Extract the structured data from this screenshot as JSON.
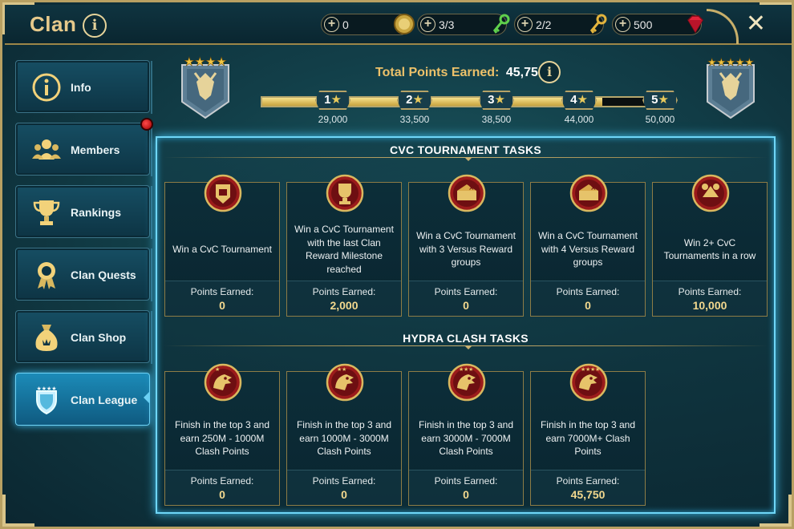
{
  "header": {
    "title": "Clan",
    "resources": [
      {
        "value": "0",
        "icon": "gold-coin-icon"
      },
      {
        "value": "3/3",
        "icon": "green-key-icon"
      },
      {
        "value": "2/2",
        "icon": "gold-key-icon"
      },
      {
        "value": "500",
        "icon": "ruby-gem-icon"
      }
    ]
  },
  "sidebar": {
    "items": [
      {
        "label": "Info",
        "icon": "info-icon"
      },
      {
        "label": "Members",
        "icon": "members-icon"
      },
      {
        "label": "Rankings",
        "icon": "trophy-icon"
      },
      {
        "label": "Clan Quests",
        "icon": "medal-icon"
      },
      {
        "label": "Clan Shop",
        "icon": "money-bag-icon"
      },
      {
        "label": "Clan League",
        "icon": "shield-icon"
      }
    ],
    "active": "Clan League"
  },
  "progress": {
    "total_label": "Total Points Earned:",
    "total_value": "45,750",
    "current_points": 45750,
    "milestones": [
      {
        "stars": "1",
        "points": "29,000",
        "value": 29000
      },
      {
        "stars": "2",
        "points": "33,500",
        "value": 33500
      },
      {
        "stars": "3",
        "points": "38,500",
        "value": 38500
      },
      {
        "stars": "4",
        "points": "44,000",
        "value": 44000
      },
      {
        "stars": "5",
        "points": "50,000",
        "value": 50000
      }
    ],
    "left_banner_stars": 4,
    "right_banner_stars": 5
  },
  "sections": {
    "cvc": {
      "title": "CVC TOURNAMENT TASKS",
      "tasks": [
        {
          "desc": "Win a CvC Tournament",
          "pts_label": "Points Earned:",
          "pts": "0",
          "icon": "cvc-helmet-badge-icon"
        },
        {
          "desc": "Win a CvC Tournament with the last Clan Reward Milestone reached",
          "pts_label": "Points Earned:",
          "pts": "2,000",
          "icon": "cvc-trophy-badge-icon"
        },
        {
          "desc": "Win a CvC Tournament with 3 Versus Reward groups",
          "pts_label": "Points Earned:",
          "pts": "0",
          "icon": "cvc-x3-badge-icon"
        },
        {
          "desc": "Win a CvC Tournament with 4 Versus Reward groups",
          "pts_label": "Points Earned:",
          "pts": "0",
          "icon": "cvc-x4-badge-icon"
        },
        {
          "desc": "Win 2+ CvC Tournaments in a row",
          "pts_label": "Points Earned:",
          "pts": "10,000",
          "icon": "cvc-streak-badge-icon"
        }
      ]
    },
    "hydra": {
      "title": "HYDRA CLASH TASKS",
      "tasks": [
        {
          "desc": "Finish in the top 3 and earn 250M - 1000M Clash Points",
          "pts_label": "Points Earned:",
          "pts": "0",
          "icon": "hydra-badge-icon"
        },
        {
          "desc": "Finish in the top 3 and earn 1000M - 3000M Clash Points",
          "pts_label": "Points Earned:",
          "pts": "0",
          "icon": "hydra-badge-icon"
        },
        {
          "desc": "Finish in the top 3 and earn 3000M - 7000M Clash Points",
          "pts_label": "Points Earned:",
          "pts": "0",
          "icon": "hydra-badge-icon"
        },
        {
          "desc": "Finish in the top 3 and earn 7000M+ Clash Points",
          "pts_label": "Points Earned:",
          "pts": "45,750",
          "icon": "hydra-badge-icon"
        }
      ]
    }
  },
  "colors": {
    "accent_gold": "#ecc16a",
    "panel_glow": "#6fd6f7",
    "badge_red": "#9b1b1b"
  }
}
